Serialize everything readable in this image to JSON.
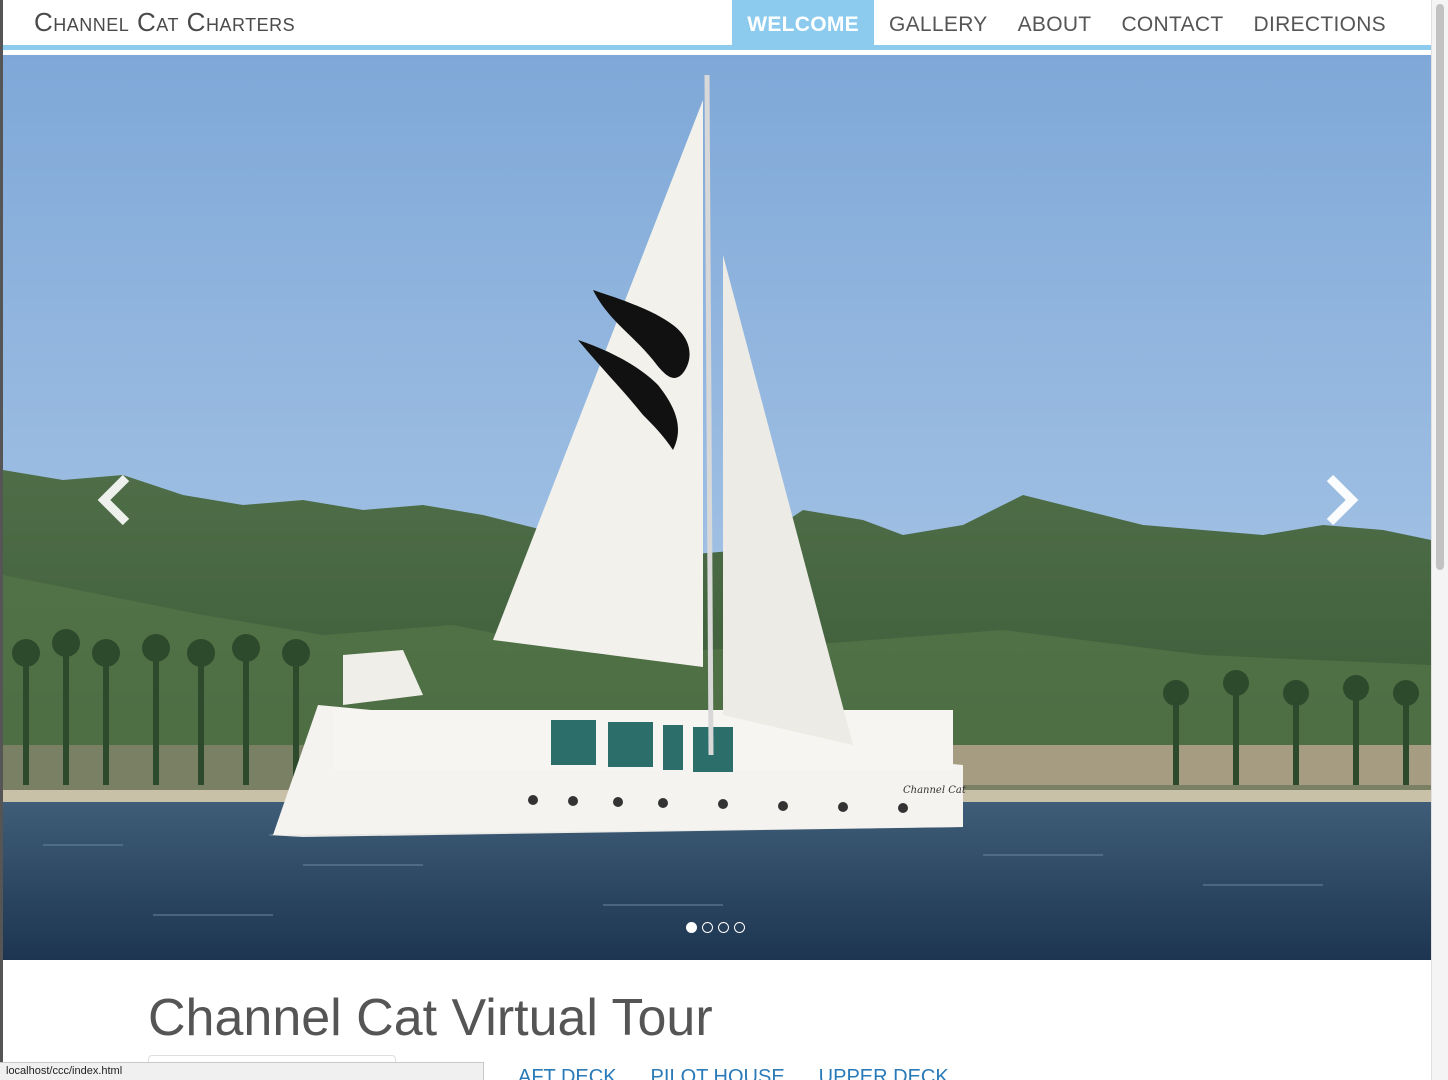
{
  "brand": "Channel Cat Charters",
  "nav": [
    {
      "label": "WELCOME",
      "active": true
    },
    {
      "label": "GALLERY",
      "active": false
    },
    {
      "label": "ABOUT",
      "active": false
    },
    {
      "label": "CONTACT",
      "active": false
    },
    {
      "label": "DIRECTIONS",
      "active": false
    }
  ],
  "carousel": {
    "slide_count": 4,
    "active_slide": 1,
    "sail_name": "Channel Cat"
  },
  "tour": {
    "title": "Channel Cat Virtual Tour",
    "tabs": [
      "AFT DECK",
      "PILOT HOUSE",
      "UPPER DECK"
    ]
  },
  "status_url": "localhost/ccc/index.html",
  "colors": {
    "accent": "#8dcbee",
    "link": "#2a7ab8"
  }
}
